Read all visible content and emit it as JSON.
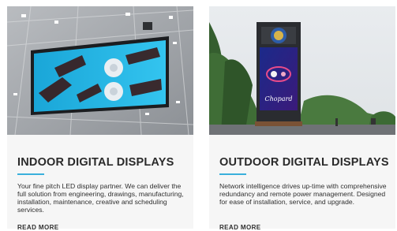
{
  "cards": [
    {
      "title": "INDOOR DIGITAL DISPLAYS",
      "description": "Your fine pitch LED display partner. We can deliver the full solution from engineering, drawings, manufacturing, installation, maintenance, creative and scheduling services.",
      "link_label": "READ MORE"
    },
    {
      "title": "OUTDOOR DIGITAL DISPLAYS",
      "description": "Network intelligence drives up-time with comprehensive redundancy and remote power management. Designed for ease of installation, service, and upgrade.",
      "link_label": "READ MORE",
      "image_text": {
        "brand": "Chopard"
      }
    }
  ],
  "colors": {
    "accent": "#3ab0dc",
    "card_bg": "#f6f6f6",
    "title": "#2a2a2a"
  }
}
